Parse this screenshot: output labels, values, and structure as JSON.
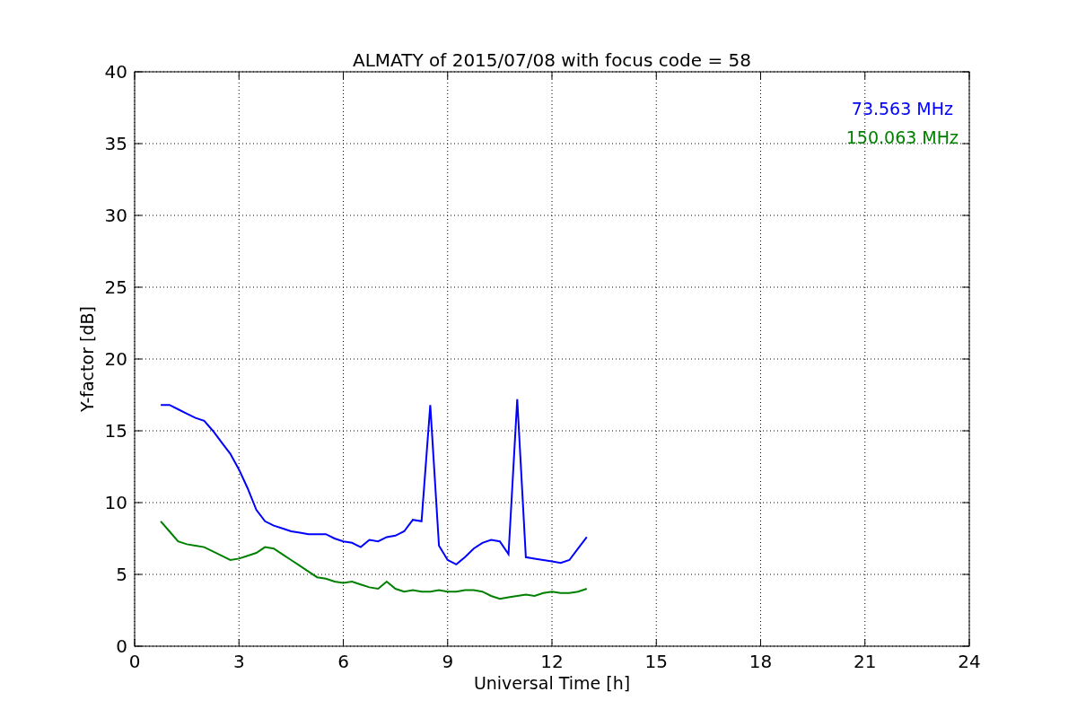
{
  "chart_data": {
    "type": "line",
    "title": "ALMATY of 2015/07/08 with focus code = 58",
    "xlabel": "Universal Time [h]",
    "ylabel": "Y-factor [dB]",
    "x": [
      0.75,
      1,
      1.25,
      1.5,
      1.75,
      2,
      2.25,
      2.5,
      2.75,
      3,
      3.25,
      3.5,
      3.75,
      4,
      4.25,
      4.5,
      4.75,
      5,
      5.25,
      5.5,
      5.75,
      6,
      6.25,
      6.5,
      6.75,
      7,
      7.25,
      7.5,
      7.75,
      8,
      8.25,
      8.5,
      8.75,
      9,
      9.25,
      9.5,
      9.75,
      10,
      10.25,
      10.5,
      10.75,
      11,
      11.25,
      11.5,
      11.75,
      12,
      12.25,
      12.5,
      12.75,
      13
    ],
    "series": [
      {
        "name": "73.563 MHz",
        "color": "#0000ff",
        "values": [
          16.8,
          16.8,
          16.5,
          16.2,
          15.9,
          15.7,
          15.0,
          14.2,
          13.4,
          12.3,
          11.0,
          9.5,
          8.7,
          8.4,
          8.2,
          8.0,
          7.9,
          7.8,
          7.8,
          7.8,
          7.5,
          7.3,
          7.2,
          6.9,
          7.4,
          7.3,
          7.6,
          7.7,
          8.0,
          8.8,
          8.7,
          16.8,
          7.0,
          6.0,
          5.7,
          6.2,
          6.8,
          7.2,
          7.4,
          7.3,
          6.4,
          17.2,
          6.2,
          6.1,
          6.0,
          5.9,
          5.8,
          6.0,
          6.8,
          7.6
        ]
      },
      {
        "name": "150.063 MHz",
        "color": "#008000",
        "values": [
          8.7,
          8.0,
          7.3,
          7.1,
          7.0,
          6.9,
          6.6,
          6.3,
          6.0,
          6.1,
          6.3,
          6.5,
          6.9,
          6.8,
          6.4,
          6.0,
          5.6,
          5.2,
          4.8,
          4.7,
          4.5,
          4.4,
          4.5,
          4.3,
          4.1,
          4.0,
          4.5,
          4.0,
          3.8,
          3.9,
          3.8,
          3.8,
          3.9,
          3.8,
          3.8,
          3.9,
          3.9,
          3.8,
          3.5,
          3.3,
          3.4,
          3.5,
          3.6,
          3.5,
          3.7,
          3.8,
          3.7,
          3.7,
          3.8,
          4.0
        ]
      }
    ],
    "xlim": [
      0,
      24
    ],
    "ylim": [
      0,
      40
    ],
    "xticks": [
      0,
      3,
      6,
      9,
      12,
      15,
      18,
      21,
      24
    ],
    "yticks": [
      0,
      5,
      10,
      15,
      20,
      25,
      30,
      35,
      40
    ],
    "grid": true
  }
}
